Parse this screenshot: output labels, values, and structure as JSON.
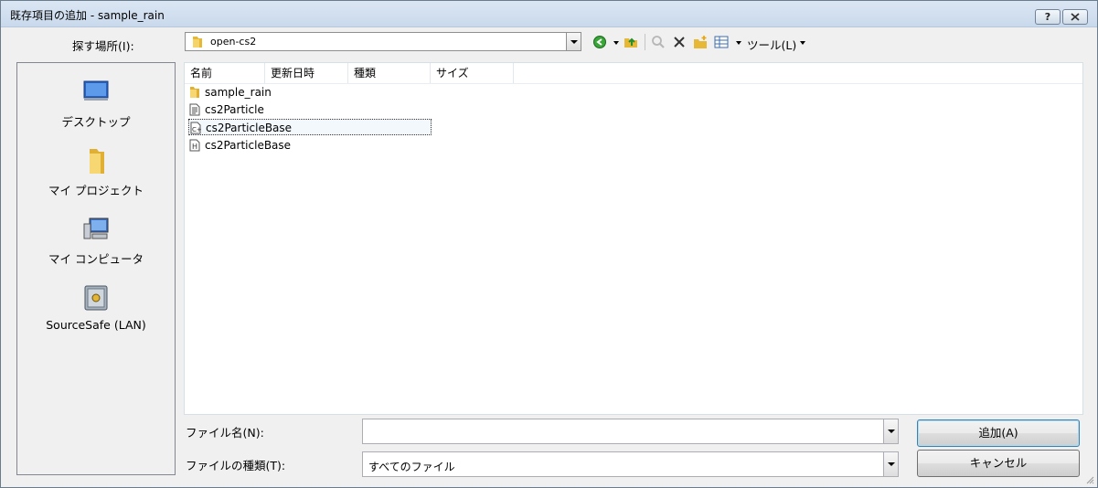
{
  "window": {
    "title": "既存項目の追加 - sample_rain",
    "help_label": "?",
    "close_label": "×"
  },
  "lookin": {
    "label": "探す場所(I):",
    "value": "open-cs2"
  },
  "toolbar": {
    "tools_label": "ツール(L)",
    "icons": [
      "back-icon",
      "up-folder-icon",
      "search-web-icon",
      "delete-icon",
      "new-folder-icon",
      "views-icon"
    ]
  },
  "places": [
    {
      "label": "デスクトップ",
      "icon": "desktop-icon"
    },
    {
      "label": "マイ プロジェクト",
      "icon": "folder-icon"
    },
    {
      "label": "マイ コンピュータ",
      "icon": "computer-icon"
    },
    {
      "label": "SourceSafe (LAN)",
      "icon": "sourcesafe-icon"
    }
  ],
  "filelist": {
    "columns": [
      "名前",
      "更新日時",
      "種類",
      "サイズ"
    ],
    "items": [
      {
        "name": "sample_rain",
        "icon": "folder-icon",
        "selected": false
      },
      {
        "name": "cs2Particle",
        "icon": "text-file-icon",
        "selected": false
      },
      {
        "name": "cs2ParticleBase",
        "icon": "cpp-file-icon",
        "selected": true
      },
      {
        "name": "cs2ParticleBase",
        "icon": "header-file-icon",
        "selected": false
      }
    ]
  },
  "filename": {
    "label": "ファイル名(N):",
    "value": ""
  },
  "filetype": {
    "label": "ファイルの種類(T):",
    "value": "すべてのファイル"
  },
  "buttons": {
    "add": "追加(A)",
    "cancel": "キャンセル"
  }
}
